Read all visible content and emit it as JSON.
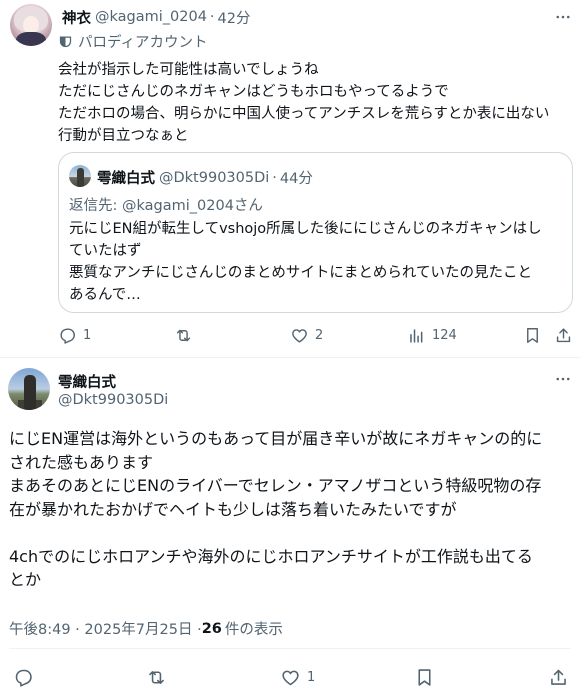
{
  "tweet1": {
    "name": "神衣",
    "handle": "@kagami_0204",
    "time": "42分",
    "parody_label": "パロディアカウント",
    "body": "会社が指示した可能性は高いでしょうね\nただにじさんじのネガキャンはどうもホロもやってるようで\nただホロの場合、明らかに中国人使ってアンチスレを荒らすとか表に出ない\n行動が目立つなぁと",
    "quote": {
      "name": "雩織白式",
      "handle": "@Dkt990305Di",
      "time": "44分",
      "reply_prefix": "返信先: ",
      "reply_mention": "@kagami_0204さん",
      "body": "元にじEN組が転生してvshojo所属した後ににじさんじのネガキャンはし\nていたはず\n悪質なアンチにじさんじのまとめサイトにまとめられていたの見たこと\nあるんで…"
    },
    "actions": {
      "reply_count": "1",
      "retweet_count": "",
      "like_count": "2",
      "views_count": "124"
    }
  },
  "tweet2": {
    "name": "雩織白式",
    "handle": "@Dkt990305Di",
    "body": "にじEN運営は海外というのもあって目が届き辛いが故にネガキャンの的に\nされた感もあります\nまあそのあとにじENのライバーでセレン・アマノザコという特級呪物の存\n在が暴かれたおかげでヘイトも少しは落ち着いたみたいですが\n\n4chでのにじホロアンチや海外のにじホロアンチサイトが工作説も出てる\nとか",
    "timestamp": "午後8:49 · 2025年7月25日 · ",
    "views_count": "26",
    "views_label": "件の表示",
    "actions": {
      "reply_count": "",
      "retweet_count": "",
      "like_count": "1"
    }
  },
  "colors": {
    "text_primary": "#0f1419",
    "text_secondary": "#536471",
    "border": "#cfd9de",
    "divider": "#eff3f4"
  },
  "icons": [
    "more-icon",
    "parody-mask-icon",
    "reply-icon",
    "retweet-icon",
    "like-icon",
    "views-icon",
    "bookmark-icon",
    "share-icon"
  ]
}
